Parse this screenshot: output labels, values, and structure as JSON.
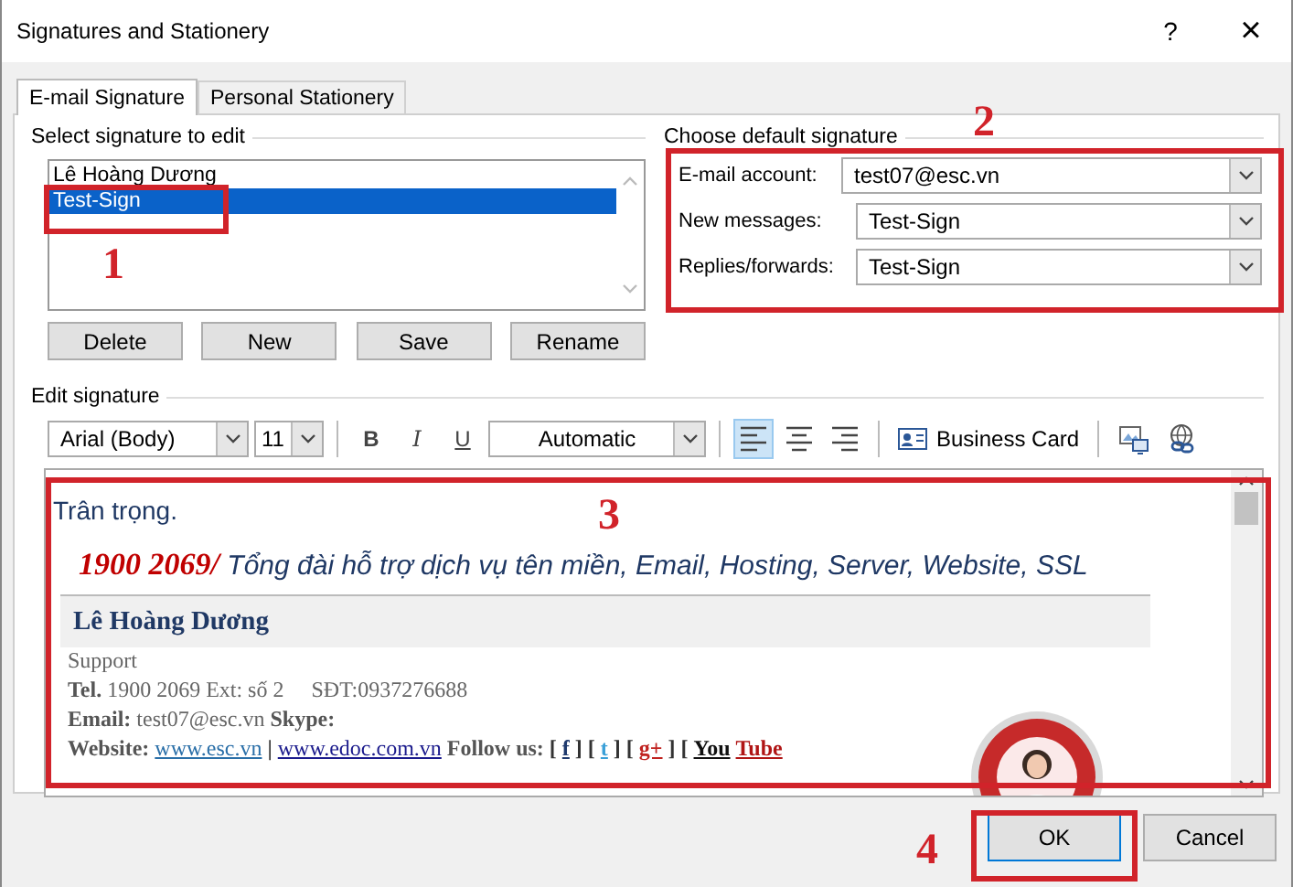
{
  "window": {
    "title": "Signatures and Stationery",
    "help": "?",
    "close": "×"
  },
  "tabs": [
    {
      "label": "E-mail Signature",
      "selected": true
    },
    {
      "label": "Personal Stationery",
      "selected": false
    }
  ],
  "signature_list": {
    "label": "Select signature to edit",
    "items": [
      {
        "label": "Lê Hoàng Dương",
        "selected": false
      },
      {
        "label": "Test-Sign",
        "selected": true
      }
    ]
  },
  "list_buttons": [
    "Delete",
    "New",
    "Save",
    "Rename"
  ],
  "defaults": {
    "label": "Choose default signature",
    "fields": [
      {
        "label": "E-mail account:",
        "value": "test07@esc.vn"
      },
      {
        "label": "New messages:",
        "value": "Test-Sign"
      },
      {
        "label": "Replies/forwards:",
        "value": "Test-Sign"
      }
    ]
  },
  "editor": {
    "label": "Edit signature",
    "font": "Arial (Body)",
    "size": "11",
    "font_color": "Automatic",
    "styles": [
      {
        "kind": "bold",
        "text": "B"
      },
      {
        "kind": "italic",
        "text": "I"
      },
      {
        "kind": "underline",
        "text": "U"
      }
    ],
    "alignment": [
      {
        "kind": "left",
        "selected": true
      },
      {
        "kind": "center",
        "selected": false
      },
      {
        "kind": "right",
        "selected": false
      }
    ],
    "business_card": "Business Card",
    "content": {
      "greeting": "Trân trọng.",
      "hotline": "1900 2069/",
      "tagline": " Tổng đài hỗ trợ dịch vụ tên miền, Email, Hosting, Server, Website, SSL",
      "name": "Lê Hoàng Dương",
      "role": "Support",
      "lines": [
        "**Tel.** 1900 2069 Ext: số 2     SĐT:0937276688",
        "**Email:** test07@esc.vn **Skype:**"
      ],
      "website_line": [
        {
          "kind": "label",
          "text": "Website:"
        },
        {
          "kind": "link",
          "text": "www.esc.vn",
          "color": "#2a6fa8"
        },
        {
          "kind": "text",
          "text": "|"
        },
        {
          "kind": "link",
          "text": "www.edoc.com.vn",
          "color": "#1a1a8c"
        },
        {
          "kind": "label",
          "text": "Follow us:"
        },
        {
          "kind": "text",
          "text": "["
        },
        {
          "kind": "link",
          "text": "f",
          "color": "#1f3a6e"
        },
        {
          "kind": "text",
          "text": "]"
        },
        {
          "kind": "text",
          "text": "["
        },
        {
          "kind": "link",
          "text": "t",
          "color": "#3aa0d8"
        },
        {
          "kind": "text",
          "text": "]"
        },
        {
          "kind": "text",
          "text": "["
        },
        {
          "kind": "link",
          "text": "g+",
          "color": "#c0221f"
        },
        {
          "kind": "text",
          "text": "]"
        },
        {
          "kind": "text",
          "text": "["
        },
        {
          "kind": "link",
          "text": "You",
          "color": "#111111"
        },
        {
          "kind": "link",
          "text": "Tube",
          "color": "#b01515"
        }
      ]
    }
  },
  "buttons": [
    {
      "label": "OK",
      "default": true
    },
    {
      "label": "Cancel",
      "default": false
    }
  ],
  "annotations": [
    "1",
    "2",
    "3",
    "4"
  ]
}
